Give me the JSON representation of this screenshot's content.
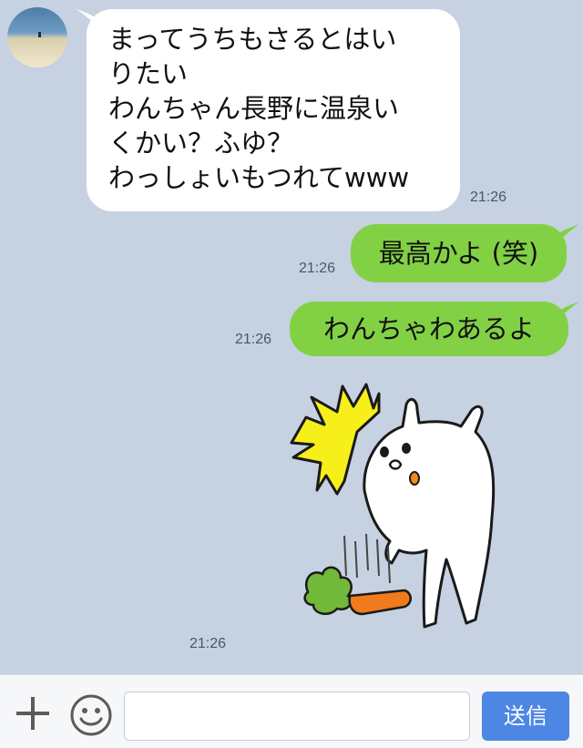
{
  "messages": [
    {
      "direction": "incoming",
      "lines": [
        "まってうちもさるとはい",
        "りたい",
        "わんちゃん長野に温泉い",
        "くかい？ふゆ？",
        "わっしょいもつれてwww"
      ],
      "time": "21:26"
    },
    {
      "direction": "outgoing",
      "text": "最高かよ (笑)",
      "time": "21:26"
    },
    {
      "direction": "outgoing",
      "text": "わんちゃわあるよ",
      "time": "21:26"
    },
    {
      "direction": "incoming",
      "sticker": "rabbit-dropping-carrot-sticker",
      "time": "21:26"
    }
  ],
  "input_bar": {
    "plus_icon": "plus-icon",
    "emoji_icon": "smiley-icon",
    "text_value": "",
    "send_label": "送信"
  },
  "colors": {
    "background": "#c6d1e1",
    "incoming_bubble": "#ffffff",
    "outgoing_bubble": "#82d145",
    "send_button": "#4e86e4"
  }
}
